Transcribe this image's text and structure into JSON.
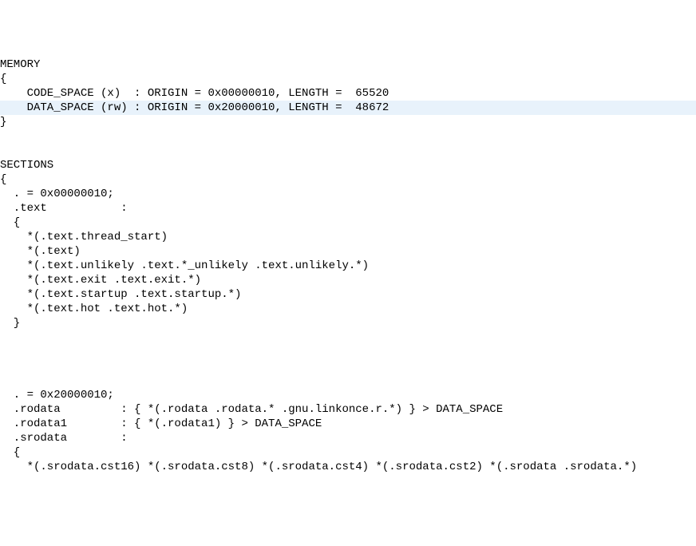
{
  "lines": [
    {
      "text": "MEMORY",
      "hl": false
    },
    {
      "text": "{",
      "hl": false
    },
    {
      "text": "    CODE_SPACE (x)  : ORIGIN = 0x00000010, LENGTH =  65520",
      "hl": false
    },
    {
      "text": "    DATA_SPACE (rw) : ORIGIN = 0x20000010, LENGTH =  48672",
      "hl": true
    },
    {
      "text": "}",
      "hl": false
    },
    {
      "text": "",
      "hl": false
    },
    {
      "text": "",
      "hl": false
    },
    {
      "text": "SECTIONS",
      "hl": false
    },
    {
      "text": "{",
      "hl": false
    },
    {
      "text": "  . = 0x00000010;",
      "hl": false
    },
    {
      "text": "  .text           :",
      "hl": false
    },
    {
      "text": "  {",
      "hl": false
    },
    {
      "text": "    *(.text.thread_start)",
      "hl": false
    },
    {
      "text": "    *(.text)",
      "hl": false
    },
    {
      "text": "    *(.text.unlikely .text.*_unlikely .text.unlikely.*)",
      "hl": false
    },
    {
      "text": "    *(.text.exit .text.exit.*)",
      "hl": false
    },
    {
      "text": "    *(.text.startup .text.startup.*)",
      "hl": false
    },
    {
      "text": "    *(.text.hot .text.hot.*)",
      "hl": false
    },
    {
      "text": "  }",
      "hl": false
    },
    {
      "text": "",
      "hl": false
    },
    {
      "text": "",
      "hl": false
    },
    {
      "text": "",
      "hl": false
    },
    {
      "text": "",
      "hl": false
    },
    {
      "text": "  . = 0x20000010;",
      "hl": false
    },
    {
      "text": "  .rodata         : { *(.rodata .rodata.* .gnu.linkonce.r.*) } > DATA_SPACE",
      "hl": false
    },
    {
      "text": "  .rodata1        : { *(.rodata1) } > DATA_SPACE",
      "hl": false
    },
    {
      "text": "  .srodata        :",
      "hl": false
    },
    {
      "text": "  {",
      "hl": false
    },
    {
      "text": "    *(.srodata.cst16) *(.srodata.cst8) *(.srodata.cst4) *(.srodata.cst2) *(.srodata .srodata.*)",
      "hl": false
    }
  ]
}
